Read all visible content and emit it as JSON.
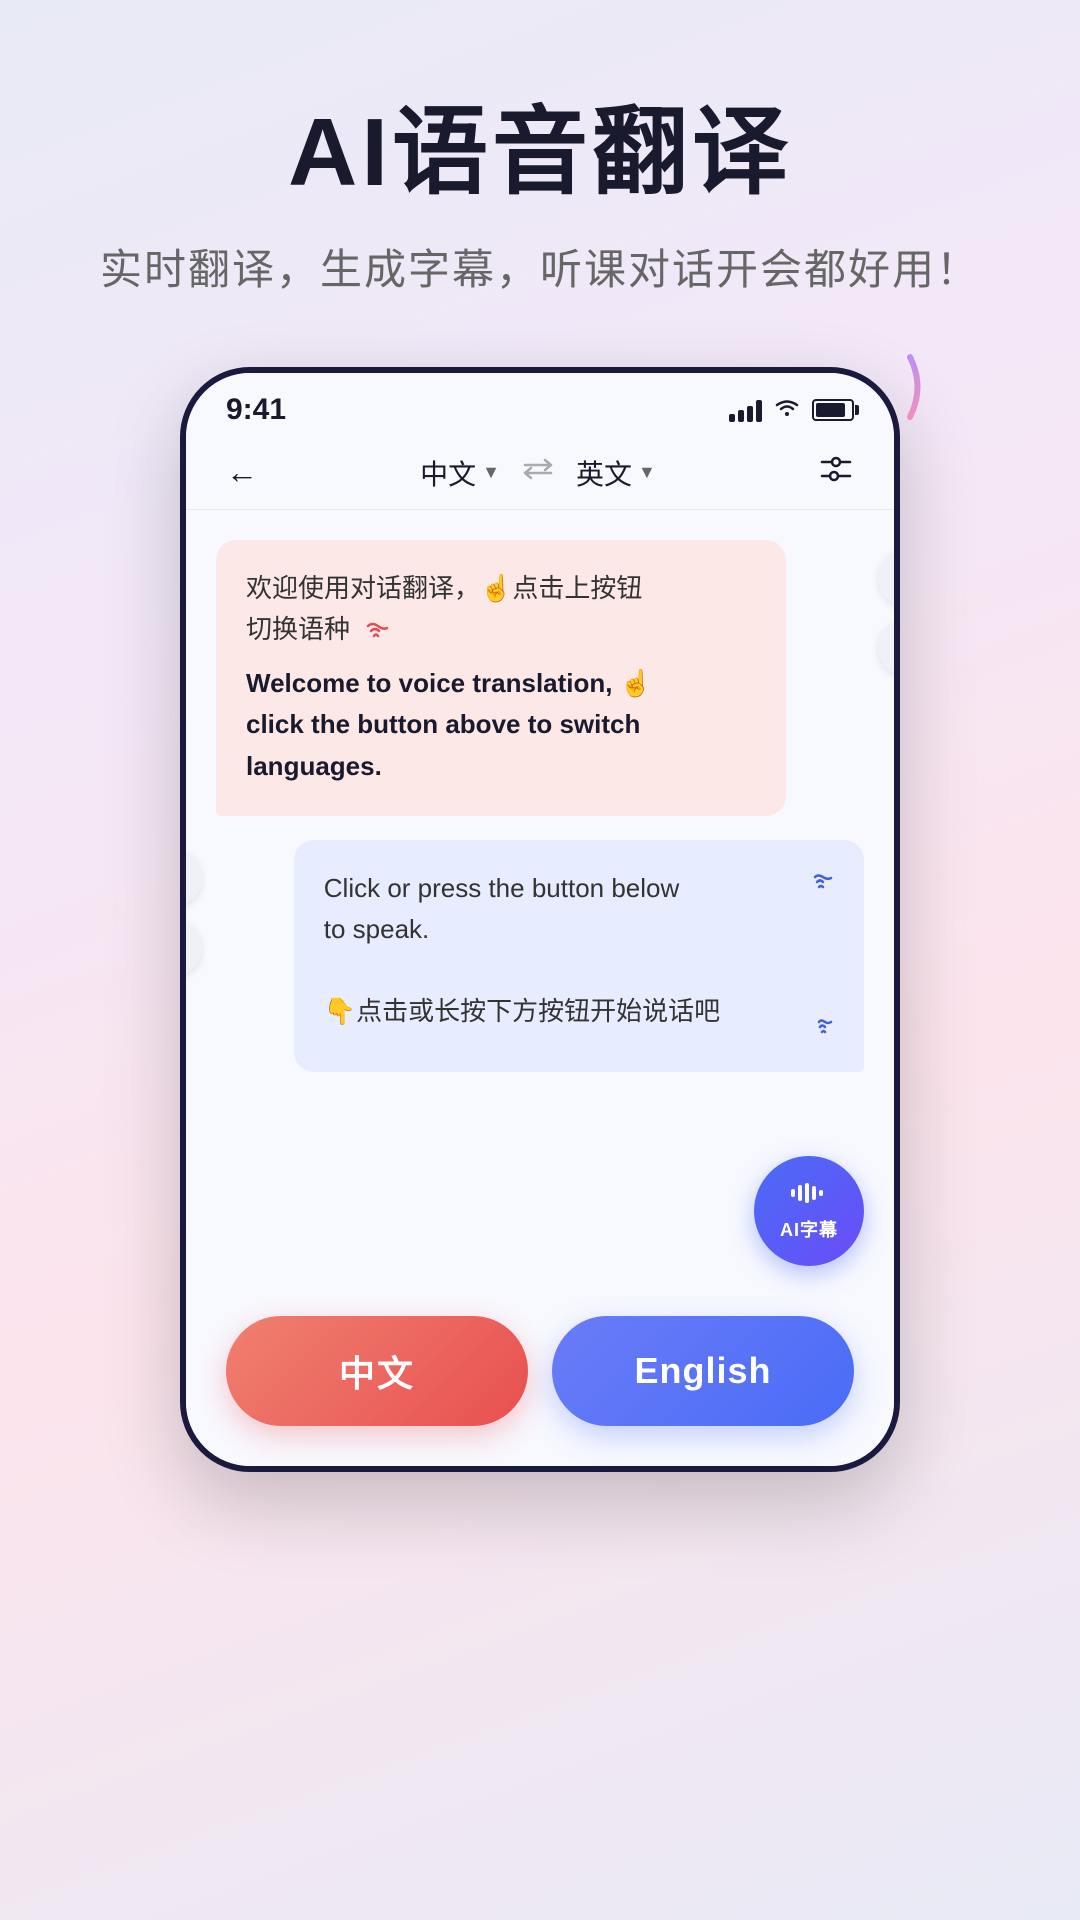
{
  "page": {
    "background": "gradient",
    "main_title": "AI语音翻译",
    "sub_title": "实时翻译，生成字幕，听课对话开会都好用！"
  },
  "status_bar": {
    "time": "9:41",
    "signal": "signal",
    "wifi": "wifi",
    "battery": "battery"
  },
  "nav": {
    "back_label": "←",
    "lang1": "中文",
    "lang1_arrow": "▼",
    "swap_icon": "⇄",
    "lang2": "英文",
    "lang2_arrow": "▼",
    "settings_icon": "≡"
  },
  "chat": {
    "bubble1": {
      "text_cn": "欢迎使用对话翻译，☝️点击上按钮切换语种",
      "text_en": "Welcome to voice translation, ☝️ click the button above to switch languages.",
      "sound_icon": "🔊"
    },
    "bubble2": {
      "text_en": "Click or press the button below to speak.",
      "text_cn": "👇点击或长按下方按钮开始说话吧",
      "sound_icon1": "🔊",
      "sound_icon2": "🔊"
    },
    "side_btn_mic": "mic",
    "side_btn_more": "...",
    "ai_subtitle_label": "AI字幕"
  },
  "bottom_buttons": {
    "chinese_label": "中文",
    "english_label": "English"
  }
}
